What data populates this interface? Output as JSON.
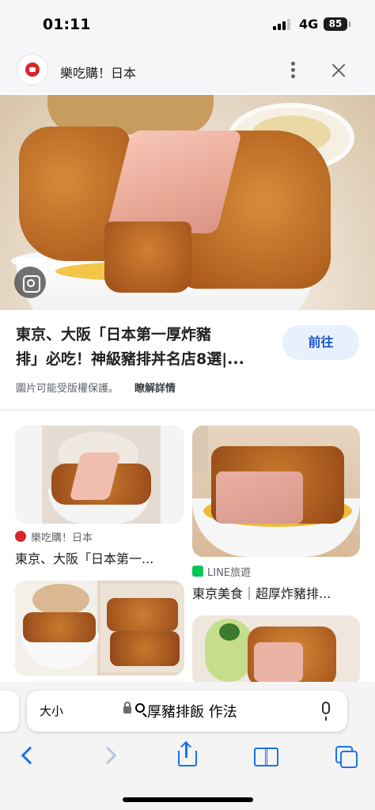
{
  "status_bar": {
    "time": "01:11",
    "network": "4G",
    "battery": "85"
  },
  "header": {
    "site_name": "樂吃購！日本",
    "icons": [
      "site-logo-icon",
      "more-vert-icon",
      "close-icon"
    ]
  },
  "result": {
    "title_line1": "東京、大阪「日本第一厚炸豬",
    "title_line2": "排」必吃！神級豬排丼名店8選|...",
    "visit_label": "前往",
    "copyright_note": "圖片可能受版權保護。",
    "learn_more": "瞭解詳情"
  },
  "related": [
    {
      "source": "樂吃購！日本",
      "title": "東京、大阪「日本第一..."
    },
    {
      "source": "LINE旅遊",
      "title": "東京美食｜超厚炸豬排..."
    }
  ],
  "address_bar": {
    "text_size_label": "大小",
    "query": "厚豬排飯 作法"
  },
  "toolbar": {
    "icons": [
      "back-icon",
      "forward-icon",
      "share-icon",
      "bookmarks-icon",
      "tabs-icon"
    ]
  },
  "colors": {
    "accent": "#1a73e8",
    "visit_button_bg": "#e8f0fe",
    "brand_red": "#d8262b",
    "line_green": "#06c755"
  }
}
